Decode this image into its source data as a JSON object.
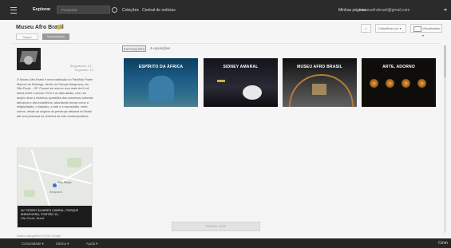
{
  "topbar": {
    "brand": "Explorar",
    "search_placeholder": "Pesquisar",
    "colecoes": "Coleções",
    "notificacoes": "Central de notícias",
    "meus_paineis": "Minhas páginas",
    "user_email": "museuafrobrasil@gmail.com"
  },
  "page": {
    "title": "Museu Afro Brasil",
    "btn_1": "Seguir",
    "btn_2": "Informações"
  },
  "controls": {
    "back": "«",
    "sort": "Classificar por ▾",
    "view": "Visualização ▾"
  },
  "sidebar": {
    "meta": "Seguidores: 22 · Seguindo: 12",
    "description": "O Museu Afro Brasil é uma instituição no Pavilhão Padre Manoel da Nóbrega, dentro do Parque Ibirapuera, em São Paulo – SP. Possui um acervo com mais de 6 mil obras entre o século XVIII e os dias atuais, com um amplo olhar à histórica, questões dos universos culturais africanos e afro-brasileiros, abordando temas como a religiosidade, o trabalho, a arte e a escravidão, entre outros, desde as origens da presença africana no Brasil até sua presença na vivência de arte contemporânea.",
    "map_city": "São Paulo",
    "map_subarea": "Ibirapuera",
    "map_caption": "AV. PEDRO ÁLVARES CABRAL, PARQUE IBIRAPUERA, PORTÃO 10...",
    "map_place": "São Paulo, Brasil",
    "map_note": "Dados cartográficos ©2014 Google"
  },
  "albums": {
    "tag": "EXPOSIÇÕES",
    "count": "4 exposições",
    "items": [
      {
        "label": "ESPÍRITO DA ÁFRICA"
      },
      {
        "label": "SIDNEY AMARAL"
      },
      {
        "label": "MUSEU AFRO BRASIL"
      },
      {
        "label": "ARTE, ADORNO"
      }
    ]
  },
  "load_more": "Mostrar mais",
  "bottombar": {
    "b1": "Comunidade ▾",
    "b2": "Idioma ▾",
    "b3": "Ajuda ▾",
    "b4": "Cmm"
  },
  "colors": {
    "topbar_bg": "#2b2b2b",
    "page_bg": "#f5f5f5",
    "title_icon": "#e2b23a"
  }
}
